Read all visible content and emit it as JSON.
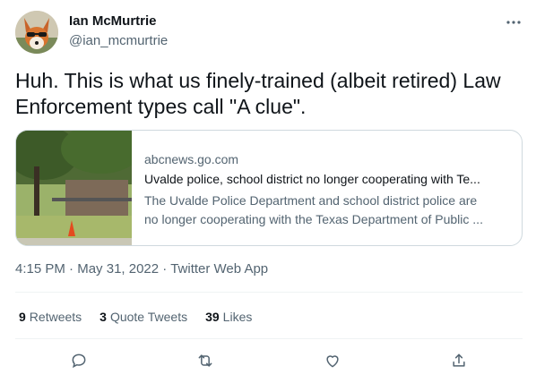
{
  "user": {
    "display_name": "Ian McMurtrie",
    "handle": "@ian_mcmurtrie",
    "avatar_icon": "fox-avatar"
  },
  "header": {
    "more_icon": "more-horizontal-icon"
  },
  "tweet": {
    "text": "Huh. This is what us finely-trained (albeit retired) Law\nEnforcement types call \"A clue\"."
  },
  "card": {
    "domain": "abcnews.go.com",
    "title": "Uvalde police, school district no longer cooperating with Te...",
    "description_line1": "The Uvalde Police Department and school district police are",
    "description_line2": "no longer cooperating with the Texas Department of Public ..."
  },
  "meta": {
    "time": "4:15 PM",
    "separator": "·",
    "date": "May 31, 2022",
    "source": "Twitter Web App"
  },
  "stats": {
    "retweets_count": "9",
    "retweets_label": "Retweets",
    "quotes_count": "3",
    "quotes_label": "Quote Tweets",
    "likes_count": "39",
    "likes_label": "Likes"
  },
  "actions": [
    "reply-icon",
    "retweet-icon",
    "like-icon",
    "share-icon"
  ],
  "colors": {
    "text_primary": "#0f1419",
    "text_secondary": "#536471",
    "border": "#cfd9de",
    "divider": "#eff3f4"
  }
}
